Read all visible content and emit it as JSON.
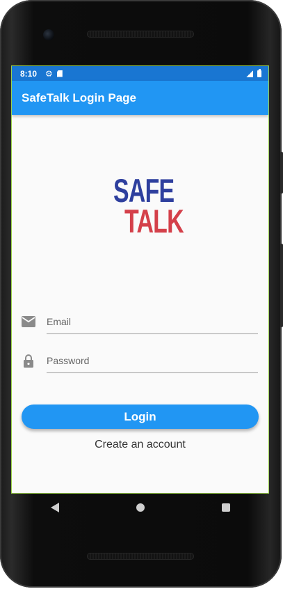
{
  "status_bar": {
    "time": "8:10",
    "icons": [
      "gear-icon",
      "sd-card-icon",
      "signal-icon",
      "battery-icon"
    ]
  },
  "app_bar": {
    "title": "SafeTalk Login Page",
    "color": "#2196f3"
  },
  "logo": {
    "line1": "SAFE",
    "line2": "TALK",
    "line1_color": "#2e3f9e",
    "line2_color": "#d4404a"
  },
  "form": {
    "email": {
      "placeholder": "Email",
      "value": "",
      "icon": "email-icon"
    },
    "password": {
      "placeholder": "Password",
      "value": "",
      "icon": "lock-icon"
    },
    "login_label": "Login",
    "create_account_label": "Create an account"
  },
  "nav_bar": {
    "buttons": [
      "back",
      "home",
      "recent-apps"
    ]
  },
  "colors": {
    "primary": "#2196f3",
    "status_bar": "#1976d2"
  }
}
